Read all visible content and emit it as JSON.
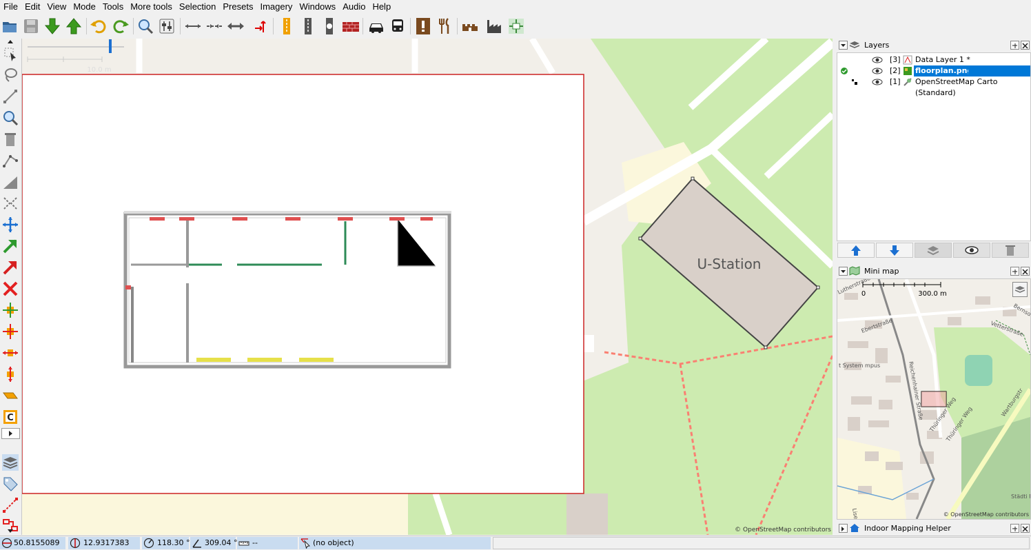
{
  "menu": [
    "File",
    "Edit",
    "View",
    "Mode",
    "Tools",
    "More tools",
    "Selection",
    "Presets",
    "Imagery",
    "Windows",
    "Audio",
    "Help"
  ],
  "map": {
    "scale_label": "10.0 m",
    "building_label": "U-Station",
    "attribution": "© OpenStreetMap contributors"
  },
  "layers_panel": {
    "title": "Layers",
    "rows": [
      {
        "index": "[3]",
        "name": "Data Layer 1 *",
        "selected": false
      },
      {
        "index": "[2]",
        "name": "floorplan.png",
        "selected": true
      },
      {
        "index": "[1]",
        "name": "OpenStreetMap Carto (Standard)",
        "selected": false
      }
    ]
  },
  "minimap_panel": {
    "title": "Mini map",
    "scale_start": "0",
    "scale_end": "300.0 m",
    "attribution": "© OpenStreetMap contributors",
    "street_labels": [
      "Lutherstraße",
      "Ebertstraße",
      "Reichenhainer Straße",
      "Thüringer Weg",
      "Thüringer Weg",
      "Vetterstraße",
      "Bernsdo",
      "Wartburgstr",
      "Städti Fried",
      "t System mpus",
      "Lise"
    ]
  },
  "indoor_panel": {
    "title": "Indoor Mapping Helper"
  },
  "status": {
    "lat": "50.8155089",
    "lon": "12.9317383",
    "heading": "118.30 °",
    "angle": "309.04 °",
    "distance": "--",
    "selection": "(no object)"
  },
  "colors": {
    "selection_blue": "#0078d7",
    "status_cell": "#c9dcf0",
    "park_green": "#cdebb0",
    "building_fill": "#d9d0c9",
    "footway_red": "#fa8072"
  }
}
